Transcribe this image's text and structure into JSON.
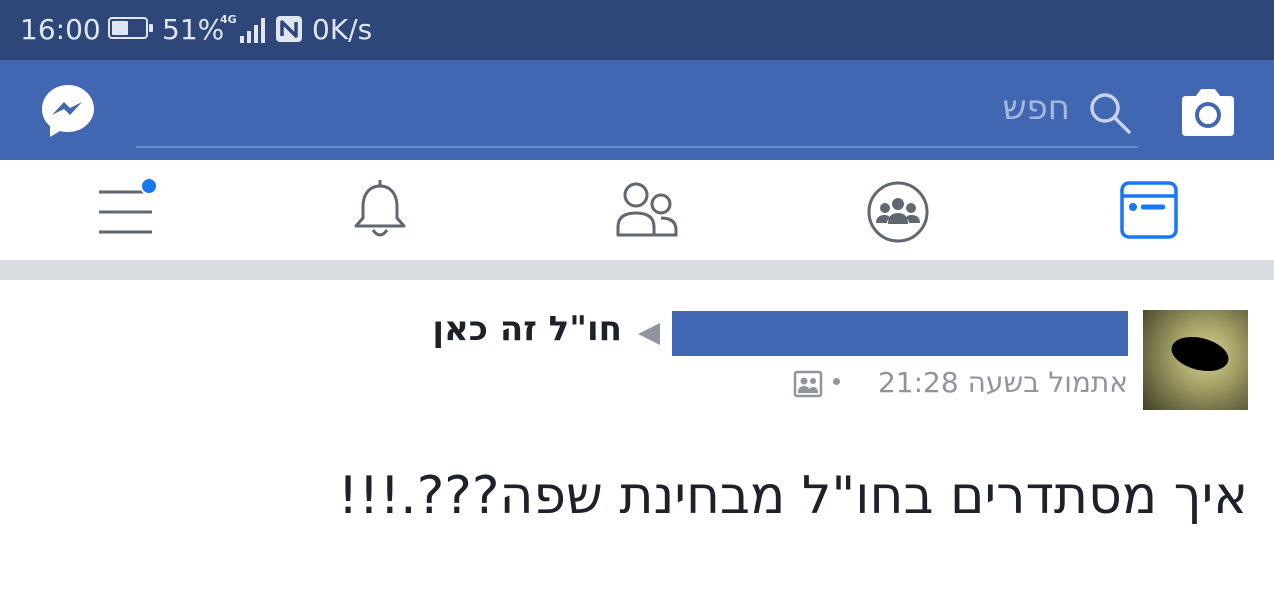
{
  "status_bar": {
    "time": "16:00",
    "battery_percent": "51%",
    "battery_level": 0.51,
    "network": "4G",
    "speed": "0K/s"
  },
  "app_bar": {
    "search_placeholder": "חפש",
    "icons": [
      "messenger-icon",
      "search-icon",
      "camera-icon"
    ],
    "colors": {
      "bar": "#4267b2",
      "status": "#2f4778"
    }
  },
  "nav_bar": {
    "items": [
      "menu-icon",
      "notifications-icon",
      "friends-icon",
      "groups-icon",
      "news-feed-icon"
    ],
    "active": "news-feed-icon",
    "menu_has_badge": true,
    "accent": "#1877f2"
  },
  "post": {
    "group_name": "חו\"ל זה כאן",
    "timestamp": "אתמול בשעה 21:28",
    "body": "איך מסתדרים בחו\"ל מבחינת שפה???.!!!"
  }
}
